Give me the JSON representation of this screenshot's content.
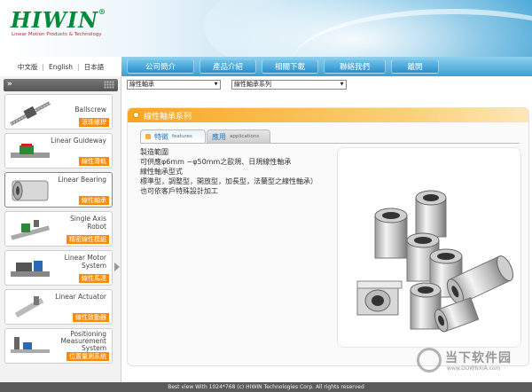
{
  "brand": {
    "logo": "HIWIN",
    "registered": "®",
    "tagline": "Linear Motion Products & Technology"
  },
  "languages": [
    "中文版",
    "English",
    "日本語"
  ],
  "nav": [
    "公司簡介",
    "產品介紹",
    "相關下載",
    "聯絡我們",
    "離開"
  ],
  "dropdowns": {
    "category": "線性軸承",
    "series": "線性軸承系列"
  },
  "sidebar": {
    "items": [
      {
        "en": "Ballscrew",
        "zh": "滾珠螺桿"
      },
      {
        "en": "Linear Guideway",
        "zh": "線性滑軌"
      },
      {
        "en": "Linear Bearing",
        "zh": "線性軸承"
      },
      {
        "en": "Single Axis Robot",
        "zh": "精密線性模組"
      },
      {
        "en": "Linear Motor System",
        "zh": "線性馬達"
      },
      {
        "en": "Linear Actuator",
        "zh": "線性致動器"
      },
      {
        "en": "Positioning Measurement System",
        "zh": "位置量測系統"
      }
    ]
  },
  "panel": {
    "title": "線性軸承系列",
    "tabs": [
      {
        "label": "特徵",
        "sub": "features"
      },
      {
        "label": "應用",
        "sub": "applications"
      }
    ],
    "description": [
      "製造範圍",
      "可供應φ6mm ~φ50mm之歐規、日規線性軸承",
      "線性軸承型式",
      "標準型，調整型，開放型，加長型，法蘭型之線性軸承）",
      "也可依客戶特殊設計加工"
    ]
  },
  "footer": "Best view With 1024*768 (c) HIWIN Technologies Corp. All rights reserved",
  "watermark": {
    "text": "当下软件园",
    "url": "www.DOWNXIA.com"
  },
  "colors": {
    "brand_green": "#008a3a",
    "nav_blue": "#3aa0d4",
    "accent_orange": "#ff8a00"
  }
}
